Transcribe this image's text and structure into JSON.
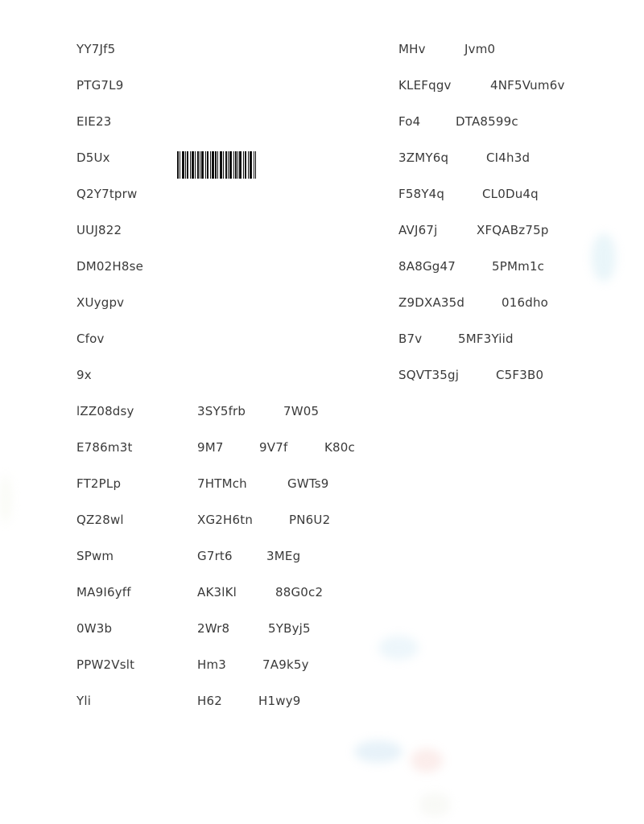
{
  "left_column": [
    {
      "cells": [
        "YY7Jf5"
      ]
    },
    {
      "cells": [
        "PTG7L9"
      ]
    },
    {
      "cells": [
        "EIE23"
      ]
    },
    {
      "cells": [
        "D5Ux"
      ]
    },
    {
      "cells": [
        "Q2Y7tprw"
      ]
    },
    {
      "cells": [
        "UUJ822"
      ]
    },
    {
      "cells": [
        "DM02H8se"
      ]
    },
    {
      "cells": [
        "XUygpv"
      ]
    },
    {
      "cells": [
        "Cfov"
      ]
    },
    {
      "cells": [
        "9x"
      ]
    },
    {
      "cells": [
        "lZZ08dsy",
        "3SY5frb",
        "7W05"
      ]
    },
    {
      "cells": [
        "E786m3t",
        "9M7",
        "9V7f",
        "K80c"
      ]
    },
    {
      "cells": [
        "FT2PLp",
        "7HTMch",
        "GWTs9"
      ]
    },
    {
      "cells": [
        "QZ28wl",
        "XG2H6tn",
        "PN6U2"
      ]
    },
    {
      "cells": [
        "SPwm",
        "G7rt6",
        "3MEg"
      ]
    },
    {
      "cells": [
        "MA9I6yff",
        "AK3lKl",
        "88G0c2"
      ]
    },
    {
      "cells": [
        "0W3b",
        "2Wr8",
        "5YByj5"
      ]
    },
    {
      "cells": [
        "PPW2Vslt",
        "Hm3",
        "7A9k5y"
      ]
    },
    {
      "cells": [
        "Yli",
        "H62",
        "H1wy9"
      ]
    }
  ],
  "right_column": [
    {
      "cells": [
        "MHv",
        "Jvm0"
      ]
    },
    {
      "cells": [
        "KLEFqgv",
        "4NF5Vum6v"
      ]
    },
    {
      "cells": [
        "Fo4",
        "DTA8599c"
      ]
    },
    {
      "cells": [
        "3ZMY6q",
        "CI4h3d"
      ]
    },
    {
      "cells": [
        "F58Y4q",
        "CL0Du4q"
      ]
    },
    {
      "cells": [
        "AVJ67j",
        "XFQABz75p"
      ]
    },
    {
      "cells": [
        "8A8Gg47",
        "5PMm1c"
      ]
    },
    {
      "cells": [
        "Z9DXA35d",
        "016dho"
      ]
    },
    {
      "cells": [
        "B7v",
        "5MF3Yiid"
      ]
    },
    {
      "cells": [
        "SQVT35gj",
        "C5F3B0"
      ]
    }
  ]
}
